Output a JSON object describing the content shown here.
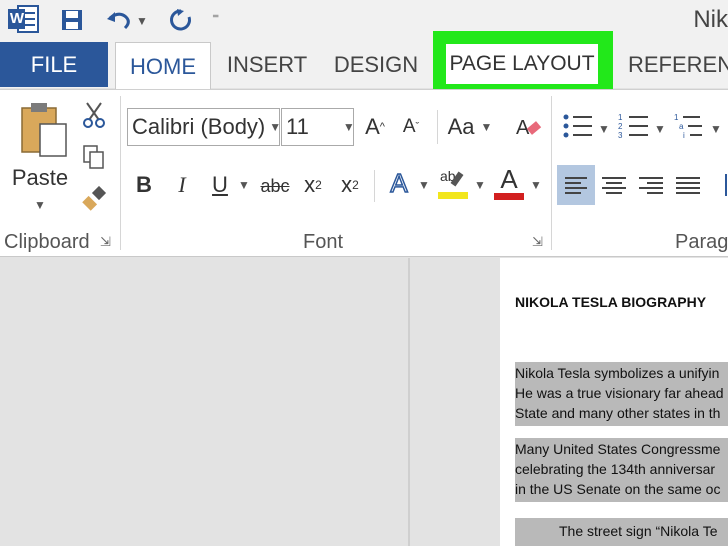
{
  "titlebar": {
    "app_icon_letter": "W",
    "doc_title": "Nik"
  },
  "quick_access": {
    "save": "save",
    "undo": "undo",
    "redo": "redo"
  },
  "tabs": {
    "file": "FILE",
    "home": "HOME",
    "insert": "INSERT",
    "design": "DESIGN",
    "page_layout": "PAGE LAYOUT",
    "references": "REFERENC"
  },
  "clipboard": {
    "paste": "Paste",
    "label": "Clipboard"
  },
  "font": {
    "name": "Calibri (Body)",
    "size": "11",
    "grow": "A",
    "shrink": "A",
    "case": "Aa",
    "bold": "B",
    "italic": "I",
    "underline": "U",
    "strike": "abc",
    "subscript": "x",
    "subscript_mark": "2",
    "superscript": "x",
    "superscript_mark": "2",
    "effects": "A",
    "highlight": "ab",
    "color": "A",
    "label": "Font"
  },
  "paragraph": {
    "label": "Paragr"
  },
  "colors": {
    "accent": "#2b579a",
    "highlight_green": "#22e81a",
    "text_highlight": "#f2e61c",
    "font_color": "#d21f1f"
  },
  "document": {
    "heading": "NIKOLA TESLA BIOGRAPHY",
    "para1": [
      "Nikola Tesla symbolizes a unifyin",
      "He was a true visionary far ahead",
      "State and many other states in th"
    ],
    "para2": [
      "Many United States Congressme",
      "celebrating the 134th anniversar",
      "in the US Senate on the same oc"
    ],
    "para3": "The street sign “Nikola Te"
  }
}
